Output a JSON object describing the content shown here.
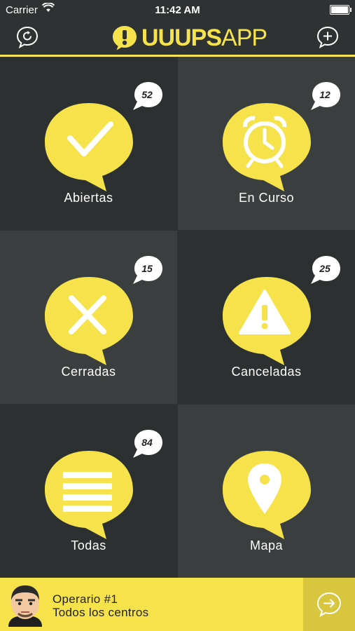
{
  "status_bar": {
    "carrier": "Carrier",
    "time": "11:42 AM"
  },
  "header": {
    "logo_bold": "UUUPS",
    "logo_light": "APP",
    "left_icon": "refresh-icon",
    "right_icon": "add-icon"
  },
  "tiles": [
    {
      "label": "Abiertas",
      "count": "52",
      "icon": "checkmark-icon"
    },
    {
      "label": "En Curso",
      "count": "12",
      "icon": "alarm-clock-icon"
    },
    {
      "label": "Cerradas",
      "count": "15",
      "icon": "close-icon"
    },
    {
      "label": "Canceladas",
      "count": "25",
      "icon": "warning-icon"
    },
    {
      "label": "Todas",
      "count": "84",
      "icon": "list-icon"
    },
    {
      "label": "Mapa",
      "count": "",
      "icon": "map-pin-icon"
    }
  ],
  "footer": {
    "user_name": "Operario #1",
    "scope": "Todos los centros",
    "action_icon": "arrow-right-icon"
  },
  "colors": {
    "accent": "#f6e24a",
    "tile_dark": "#2c3031",
    "tile_light": "#3b3e3f"
  }
}
